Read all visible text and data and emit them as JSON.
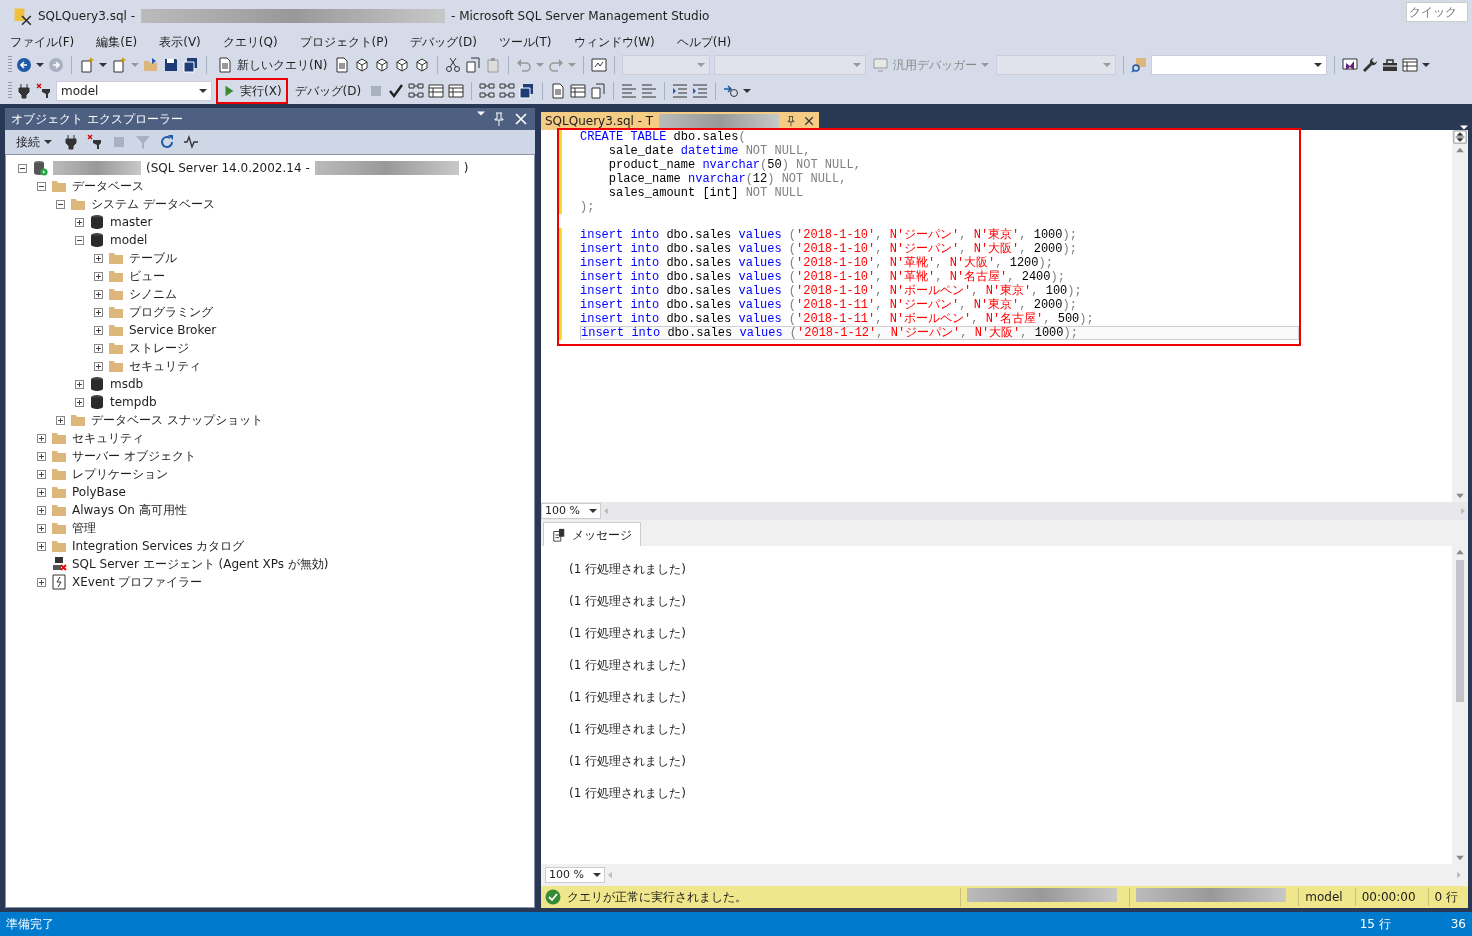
{
  "window": {
    "title_prefix": "SQLQuery3.sql -",
    "title_suffix": "- Microsoft SQL Server Management Studio",
    "quick_launch": {
      "placeholder": "クイック"
    }
  },
  "menu": [
    {
      "label": "ファイル(F)"
    },
    {
      "label": "編集(E)"
    },
    {
      "label": "表示(V)"
    },
    {
      "label": "クエリ(Q)"
    },
    {
      "label": "プロジェクト(P)"
    },
    {
      "label": "デバッグ(D)"
    },
    {
      "label": "ツール(T)"
    },
    {
      "label": "ウィンドウ(W)"
    },
    {
      "label": "ヘルプ(H)"
    }
  ],
  "toolbar": {
    "new_query": "新しいクエリ(N)",
    "debugger": "汎用デバッガー",
    "database": "model",
    "execute": "実行(X)",
    "debug": "デバッグ(D)"
  },
  "object_explorer": {
    "title": "オブジェクト エクスプローラー",
    "connect": "接続",
    "tree": [
      {
        "kind": "server",
        "label": "(SQL Server 14.0.2002.14 -",
        "label_end": ")",
        "expanded": true,
        "children": [
          {
            "kind": "folder",
            "label": "データベース",
            "expanded": true,
            "children": [
              {
                "kind": "folder",
                "label": "システム データベース",
                "expanded": true,
                "children": [
                  {
                    "kind": "database",
                    "label": "master",
                    "expanded": false
                  },
                  {
                    "kind": "database",
                    "label": "model",
                    "expanded": true,
                    "children": [
                      {
                        "kind": "folder",
                        "label": "テーブル",
                        "expanded": false
                      },
                      {
                        "kind": "folder",
                        "label": "ビュー",
                        "expanded": false
                      },
                      {
                        "kind": "folder",
                        "label": "シノニム",
                        "expanded": false
                      },
                      {
                        "kind": "folder",
                        "label": "プログラミング",
                        "expanded": false
                      },
                      {
                        "kind": "folder",
                        "label": "Service Broker",
                        "expanded": false
                      },
                      {
                        "kind": "folder",
                        "label": "ストレージ",
                        "expanded": false
                      },
                      {
                        "kind": "folder",
                        "label": "セキュリティ",
                        "expanded": false
                      }
                    ]
                  },
                  {
                    "kind": "database",
                    "label": "msdb",
                    "expanded": false
                  },
                  {
                    "kind": "database",
                    "label": "tempdb",
                    "expanded": false
                  }
                ]
              },
              {
                "kind": "folder",
                "label": "データベース スナップショット",
                "expanded": false
              }
            ]
          },
          {
            "kind": "folder",
            "label": "セキュリティ",
            "expanded": false
          },
          {
            "kind": "folder",
            "label": "サーバー オブジェクト",
            "expanded": false
          },
          {
            "kind": "folder",
            "label": "レプリケーション",
            "expanded": false
          },
          {
            "kind": "folder",
            "label": "PolyBase",
            "expanded": false
          },
          {
            "kind": "folder",
            "label": "Always On 高可用性",
            "expanded": false
          },
          {
            "kind": "folder",
            "label": "管理",
            "expanded": false
          },
          {
            "kind": "folder",
            "label": "Integration Services カタログ",
            "expanded": false
          },
          {
            "kind": "agent",
            "label": "SQL Server エージェント (Agent XPs が無効)"
          },
          {
            "kind": "xevent",
            "label": "XEvent プロファイラー",
            "expanded": false
          }
        ]
      }
    ]
  },
  "editor": {
    "tab": "SQLQuery3.sql - T",
    "zoom": "100 %",
    "lines": [
      {
        "kind": "code",
        "current": false,
        "tokens": [
          {
            "kind": "kw",
            "t": "CREATE TABLE"
          },
          {
            "kind": "txt",
            "t": " dbo.sales"
          },
          {
            "kind": "op",
            "t": "("
          }
        ]
      },
      {
        "kind": "code",
        "current": false,
        "tokens": [
          {
            "kind": "txt",
            "t": "    sale_date "
          },
          {
            "kind": "kw",
            "t": "datetime"
          },
          {
            "kind": "op",
            "t": " NOT NULL,"
          }
        ]
      },
      {
        "kind": "code",
        "current": false,
        "tokens": [
          {
            "kind": "txt",
            "t": "    product_name "
          },
          {
            "kind": "kw",
            "t": "nvarchar"
          },
          {
            "kind": "op",
            "t": "("
          },
          {
            "kind": "txt",
            "t": "50"
          },
          {
            "kind": "op",
            "t": ") NOT NULL,"
          }
        ]
      },
      {
        "kind": "code",
        "current": false,
        "tokens": [
          {
            "kind": "txt",
            "t": "    place_name "
          },
          {
            "kind": "kw",
            "t": "nvarchar"
          },
          {
            "kind": "op",
            "t": "("
          },
          {
            "kind": "txt",
            "t": "12"
          },
          {
            "kind": "op",
            "t": ") NOT NULL,"
          }
        ]
      },
      {
        "kind": "code",
        "current": false,
        "tokens": [
          {
            "kind": "txt",
            "t": "    sales_amount [int] "
          },
          {
            "kind": "op",
            "t": "NOT NULL"
          }
        ]
      },
      {
        "kind": "code",
        "current": false,
        "tokens": [
          {
            "kind": "op",
            "t": ");"
          }
        ]
      },
      {
        "kind": "blank",
        "current": false
      },
      {
        "kind": "code",
        "current": false,
        "tokens": [
          {
            "kind": "kw",
            "t": "insert into"
          },
          {
            "kind": "txt",
            "t": " dbo.sales "
          },
          {
            "kind": "kw",
            "t": "values"
          },
          {
            "kind": "op",
            "t": " ("
          },
          {
            "kind": "str",
            "t": "'2018-1-10'"
          },
          {
            "kind": "op",
            "t": ", "
          },
          {
            "kind": "str",
            "t": "N'ジーパン'"
          },
          {
            "kind": "op",
            "t": ", "
          },
          {
            "kind": "str",
            "t": "N'東京'"
          },
          {
            "kind": "op",
            "t": ", "
          },
          {
            "kind": "txt",
            "t": "1000"
          },
          {
            "kind": "op",
            "t": ");"
          }
        ]
      },
      {
        "kind": "code",
        "current": false,
        "tokens": [
          {
            "kind": "kw",
            "t": "insert into"
          },
          {
            "kind": "txt",
            "t": " dbo.sales "
          },
          {
            "kind": "kw",
            "t": "values"
          },
          {
            "kind": "op",
            "t": " ("
          },
          {
            "kind": "str",
            "t": "'2018-1-10'"
          },
          {
            "kind": "op",
            "t": ", "
          },
          {
            "kind": "str",
            "t": "N'ジーパン'"
          },
          {
            "kind": "op",
            "t": ", "
          },
          {
            "kind": "str",
            "t": "N'大阪'"
          },
          {
            "kind": "op",
            "t": ", "
          },
          {
            "kind": "txt",
            "t": "2000"
          },
          {
            "kind": "op",
            "t": ");"
          }
        ]
      },
      {
        "kind": "code",
        "current": false,
        "tokens": [
          {
            "kind": "kw",
            "t": "insert into"
          },
          {
            "kind": "txt",
            "t": " dbo.sales "
          },
          {
            "kind": "kw",
            "t": "values"
          },
          {
            "kind": "op",
            "t": " ("
          },
          {
            "kind": "str",
            "t": "'2018-1-10'"
          },
          {
            "kind": "op",
            "t": ", "
          },
          {
            "kind": "str",
            "t": "N'革靴'"
          },
          {
            "kind": "op",
            "t": ", "
          },
          {
            "kind": "str",
            "t": "N'大阪'"
          },
          {
            "kind": "op",
            "t": ", "
          },
          {
            "kind": "txt",
            "t": "1200"
          },
          {
            "kind": "op",
            "t": ");"
          }
        ]
      },
      {
        "kind": "code",
        "current": false,
        "tokens": [
          {
            "kind": "kw",
            "t": "insert into"
          },
          {
            "kind": "txt",
            "t": " dbo.sales "
          },
          {
            "kind": "kw",
            "t": "values"
          },
          {
            "kind": "op",
            "t": " ("
          },
          {
            "kind": "str",
            "t": "'2018-1-10'"
          },
          {
            "kind": "op",
            "t": ", "
          },
          {
            "kind": "str",
            "t": "N'革靴'"
          },
          {
            "kind": "op",
            "t": ", "
          },
          {
            "kind": "str",
            "t": "N'名古屋'"
          },
          {
            "kind": "op",
            "t": ", "
          },
          {
            "kind": "txt",
            "t": "2400"
          },
          {
            "kind": "op",
            "t": ");"
          }
        ]
      },
      {
        "kind": "code",
        "current": false,
        "tokens": [
          {
            "kind": "kw",
            "t": "insert into"
          },
          {
            "kind": "txt",
            "t": " dbo.sales "
          },
          {
            "kind": "kw",
            "t": "values"
          },
          {
            "kind": "op",
            "t": " ("
          },
          {
            "kind": "str",
            "t": "'2018-1-10'"
          },
          {
            "kind": "op",
            "t": ", "
          },
          {
            "kind": "str",
            "t": "N'ボールペン'"
          },
          {
            "kind": "op",
            "t": ", "
          },
          {
            "kind": "str",
            "t": "N'東京'"
          },
          {
            "kind": "op",
            "t": ", "
          },
          {
            "kind": "txt",
            "t": "100"
          },
          {
            "kind": "op",
            "t": ");"
          }
        ]
      },
      {
        "kind": "code",
        "current": false,
        "tokens": [
          {
            "kind": "kw",
            "t": "insert into"
          },
          {
            "kind": "txt",
            "t": " dbo.sales "
          },
          {
            "kind": "kw",
            "t": "values"
          },
          {
            "kind": "op",
            "t": " ("
          },
          {
            "kind": "str",
            "t": "'2018-1-11'"
          },
          {
            "kind": "op",
            "t": ", "
          },
          {
            "kind": "str",
            "t": "N'ジーパン'"
          },
          {
            "kind": "op",
            "t": ", "
          },
          {
            "kind": "str",
            "t": "N'東京'"
          },
          {
            "kind": "op",
            "t": ", "
          },
          {
            "kind": "txt",
            "t": "2000"
          },
          {
            "kind": "op",
            "t": ");"
          }
        ]
      },
      {
        "kind": "code",
        "current": false,
        "tokens": [
          {
            "kind": "kw",
            "t": "insert into"
          },
          {
            "kind": "txt",
            "t": " dbo.sales "
          },
          {
            "kind": "kw",
            "t": "values"
          },
          {
            "kind": "op",
            "t": " ("
          },
          {
            "kind": "str",
            "t": "'2018-1-11'"
          },
          {
            "kind": "op",
            "t": ", "
          },
          {
            "kind": "str",
            "t": "N'ボールペン'"
          },
          {
            "kind": "op",
            "t": ", "
          },
          {
            "kind": "str",
            "t": "N'名古屋'"
          },
          {
            "kind": "op",
            "t": ", "
          },
          {
            "kind": "txt",
            "t": "500"
          },
          {
            "kind": "op",
            "t": ");"
          }
        ]
      },
      {
        "kind": "code",
        "current": true,
        "tokens": [
          {
            "kind": "kw",
            "t": "insert into"
          },
          {
            "kind": "txt",
            "t": " dbo.sales "
          },
          {
            "kind": "kw",
            "t": "values"
          },
          {
            "kind": "op",
            "t": " ("
          },
          {
            "kind": "str",
            "t": "'2018-1-12'"
          },
          {
            "kind": "op",
            "t": ", "
          },
          {
            "kind": "str",
            "t": "N'ジーパン'"
          },
          {
            "kind": "op",
            "t": ", "
          },
          {
            "kind": "str",
            "t": "N'大阪'"
          },
          {
            "kind": "op",
            "t": ", "
          },
          {
            "kind": "txt",
            "t": "1000"
          },
          {
            "kind": "op",
            "t": ");"
          }
        ]
      }
    ]
  },
  "results": {
    "tab": "メッセージ",
    "zoom": "100 %",
    "messages": [
      "(1  行処理されました)",
      "(1  行処理されました)",
      "(1  行処理されました)",
      "(1  行処理されました)",
      "(1  行処理されました)",
      "(1  行処理されました)",
      "(1  行処理されました)",
      "(1  行処理されました)"
    ],
    "status": {
      "succeeded": true,
      "text": "クエリが正常に実行されました。",
      "database": "model",
      "elapsed": "00:00:00",
      "rows": "0 行"
    }
  },
  "status_bar": {
    "text": "準備完了",
    "line": "15 行",
    "column": "36"
  }
}
